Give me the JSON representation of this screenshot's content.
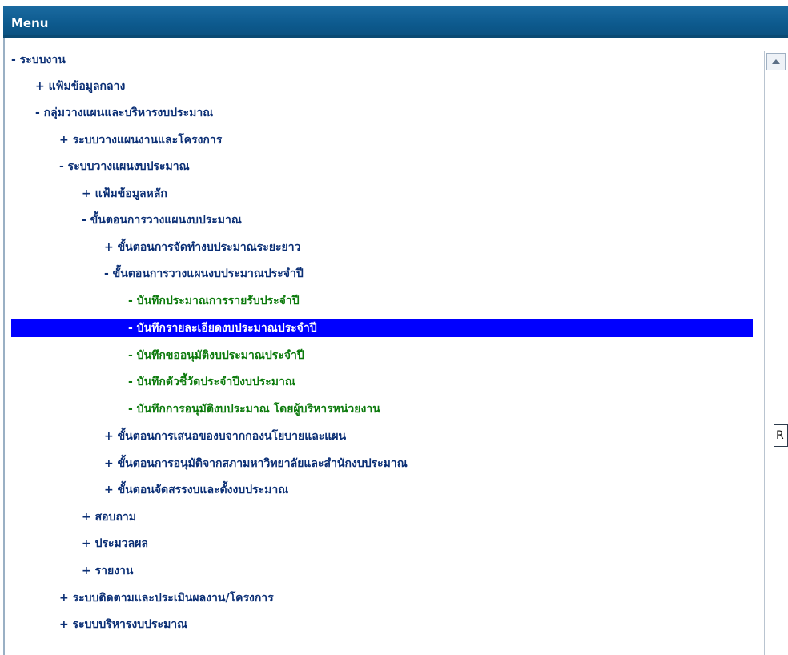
{
  "header": {
    "title": "Menu"
  },
  "tree": [
    {
      "label": "- ระบบงาน",
      "type": "node"
    },
    {
      "label": "+ แฟ้มข้อมูลกลาง",
      "type": "node"
    },
    {
      "label": "- กลุ่มวางแผนและบริหารงบประมาณ",
      "type": "node"
    },
    {
      "label": "+ ระบบวางแผนงานและโครงการ",
      "type": "node"
    },
    {
      "label": "- ระบบวางแผนงบประมาณ",
      "type": "node"
    },
    {
      "label": "+ แฟ้มข้อมูลหลัก",
      "type": "node"
    },
    {
      "label": "- ขั้นตอนการวางแผนงบประมาณ",
      "type": "node"
    },
    {
      "label": "+ ขั้นตอนการจัดทำงบประมาณระยะยาว",
      "type": "node"
    },
    {
      "label": "- ขั้นตอนการวางแผนงบประมาณประจำปี",
      "type": "node"
    },
    {
      "label": "- บันทึกประมาณการรายรับประจำปี",
      "type": "leaf"
    },
    {
      "label": "- บันทึกรายละเอียดงบประมาณประจำปี",
      "type": "leaf-selected"
    },
    {
      "label": "- บันทึกขออนุมัติงบประมาณประจำปี",
      "type": "leaf"
    },
    {
      "label": "- บันทึกตัวชี้วัดประจำปีงบประมาณ",
      "type": "leaf"
    },
    {
      "label": "- บันทึกการอนุมัติงบประมาณ โดยผู้บริหารหน่วยงาน",
      "type": "leaf"
    },
    {
      "label": "+ ขั้นตอนการเสนอของบจากกองนโยบายและแผน",
      "type": "node"
    },
    {
      "label": "+ ขั้นตอนการอนุมัติจากสภามหาวิทยาลัยและสำนักงบประมาณ",
      "type": "node"
    },
    {
      "label": "+ ขั้นตอนจัดสรรงบและตั้งงบประมาณ",
      "type": "node"
    },
    {
      "label": "+ สอบถาม",
      "type": "node"
    },
    {
      "label": "+ ประมวลผล",
      "type": "node"
    },
    {
      "label": "+ รายงาน",
      "type": "node"
    },
    {
      "label": "+ ระบบติดตามและประเมินผลงาน/โครงการ",
      "type": "node"
    },
    {
      "label": "+ ระบบบริหารงบประมาณ",
      "type": "node"
    }
  ],
  "side_fragment": {
    "text": "R"
  },
  "colors": {
    "header_bg": "#0d5a8e",
    "node_text": "#0b2f75",
    "leaf_text": "#0c7a0c",
    "selected_bg": "#0000ff"
  }
}
